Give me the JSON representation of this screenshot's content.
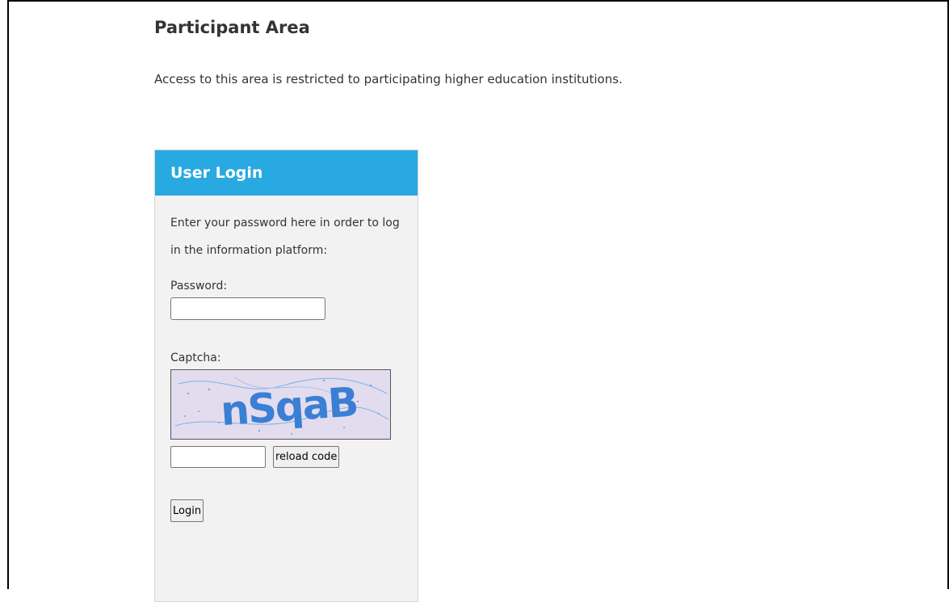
{
  "page": {
    "title": "Participant Area",
    "intro": "Access to this area is restricted to participating higher education institutions."
  },
  "login": {
    "header": "User Login",
    "instructions": "Enter your password here in order to log in the information platform:",
    "password_label": "Password:",
    "password_value": "",
    "captcha_label": "Captcha:",
    "captcha_text": "nSqaB",
    "captcha_value": "",
    "reload_label": "reload code",
    "login_label": "Login"
  },
  "colors": {
    "header_bg": "#29a9e1",
    "panel_bg": "#f2f2f2",
    "captcha_bg": "#e3dcee",
    "captcha_text": "#3a7fd4"
  }
}
